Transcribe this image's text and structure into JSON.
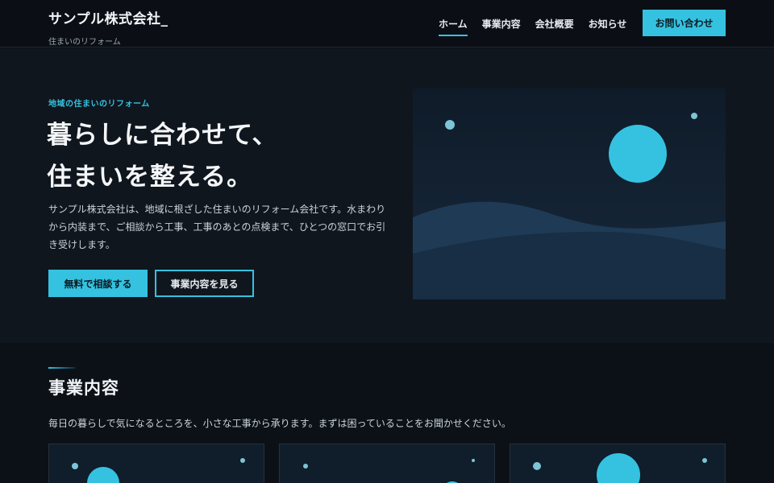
{
  "header": {
    "brand_name": "サンプル株式会社_",
    "brand_tagline": "住まいのリフォーム",
    "nav": [
      {
        "label": "ホーム",
        "active": true
      },
      {
        "label": "事業内容",
        "active": false
      },
      {
        "label": "会社概要",
        "active": false
      },
      {
        "label": "お知らせ",
        "active": false
      }
    ],
    "contact_label": "お問い合わせ"
  },
  "hero": {
    "eyebrow": "地域の住まいのリフォーム",
    "title_line1": "暮らしに合わせて、",
    "title_line2": "住まいを整える。",
    "description": "サンプル株式会社は、地域に根ざした住まいのリフォーム会社です。水まわりから内装まで、ご相談から工事、工事のあとの点検まで、ひとつの窓口でお引き受けします。",
    "primary_button": "無料で相談する",
    "secondary_button": "事業内容を見る"
  },
  "services": {
    "title": "事業内容",
    "description": "毎日の暮らしで気になるところを、小さな工事から承ります。まずは困っていることをお聞かせください。"
  },
  "colors": {
    "accent": "#35c2e0",
    "background": "#0c1117",
    "hero_background": "#10161e"
  }
}
